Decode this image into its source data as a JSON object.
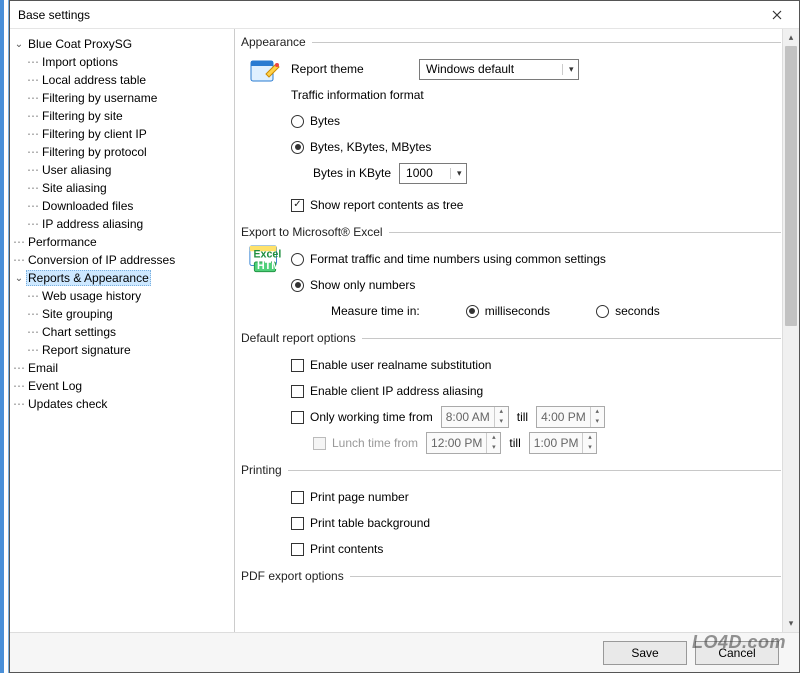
{
  "window": {
    "title": "Base settings"
  },
  "tree": {
    "root": {
      "label": "Blue Coat ProxySG",
      "children": [
        "Import options",
        "Local address table",
        "Filtering by username",
        "Filtering by site",
        "Filtering by client IP",
        "Filtering by protocol",
        "User aliasing",
        "Site aliasing",
        "Downloaded files",
        "IP address aliasing"
      ]
    },
    "items": [
      "Performance",
      "Conversion of IP addresses"
    ],
    "reports": {
      "label": "Reports & Appearance",
      "children": [
        "Web usage history",
        "Site grouping",
        "Chart settings",
        "Report signature"
      ]
    },
    "rest": [
      "Email",
      "Event Log",
      "Updates check"
    ]
  },
  "appearance": {
    "title": "Appearance",
    "theme_label": "Report theme",
    "theme_value": "Windows default",
    "traffic_format_label": "Traffic information format",
    "opt_bytes": "Bytes",
    "opt_kbytes": "Bytes, KBytes, MBytes",
    "kb_label": "Bytes in KByte",
    "kb_value": "1000",
    "show_tree": "Show report contents as tree"
  },
  "excel": {
    "title": "Export to Microsoft® Excel",
    "opt_common": "Format traffic and time numbers using common settings",
    "opt_numbers": "Show only numbers",
    "measure_label": "Measure time in:",
    "ms": "milliseconds",
    "sec": "seconds"
  },
  "defaults": {
    "title": "Default report options",
    "realname": "Enable user realname substitution",
    "ip_alias": "Enable client IP address aliasing",
    "working": "Only working time from",
    "till": "till",
    "t1": "8:00 AM",
    "t2": "4:00 PM",
    "lunch": "Lunch time from",
    "t3": "12:00 PM",
    "t4": "1:00 PM"
  },
  "printing": {
    "title": "Printing",
    "p1": "Print page number",
    "p2": "Print table background",
    "p3": "Print contents"
  },
  "pdf": {
    "title": "PDF export options"
  },
  "footer": {
    "save": "Save",
    "cancel": "Cancel"
  },
  "watermark": "LO4D.com"
}
